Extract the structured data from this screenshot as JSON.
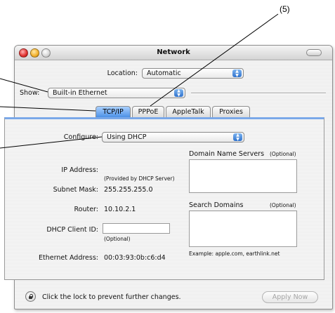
{
  "callout": {
    "number": "(5)"
  },
  "window": {
    "title": "Network",
    "location_label": "Location:",
    "location_value": "Automatic",
    "show_label": "Show:",
    "show_value": "Built-in Ethernet"
  },
  "tabs": [
    {
      "label": "TCP/IP",
      "active": true
    },
    {
      "label": "PPPoE",
      "active": false
    },
    {
      "label": "AppleTalk",
      "active": false
    },
    {
      "label": "Proxies",
      "active": false
    }
  ],
  "tcpip": {
    "configure_label": "Configure:",
    "configure_value": "Using DHCP",
    "ip_label": "IP Address:",
    "ip_note": "(Provided by DHCP Server)",
    "subnet_label": "Subnet Mask:",
    "subnet_value": "255.255.255.0",
    "router_label": "Router:",
    "router_value": "10.10.2.1",
    "dhcp_id_label": "DHCP Client ID:",
    "dhcp_id_value": "",
    "dhcp_id_note": "(Optional)",
    "ethernet_label": "Ethernet Address:",
    "ethernet_value": "00:03:93:0b:c6:d4",
    "dns_title": "Domain Name Servers",
    "dns_optional": "(Optional)",
    "dns_value": "",
    "search_title": "Search Domains",
    "search_optional": "(Optional)",
    "search_value": "",
    "search_example": "Example: apple.com, earthlink.net"
  },
  "footer": {
    "lock_text": "Click the lock to prevent further changes.",
    "apply_label": "Apply Now"
  }
}
